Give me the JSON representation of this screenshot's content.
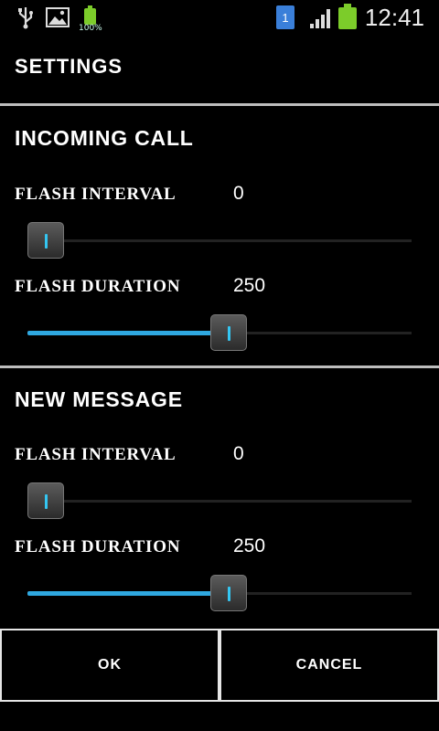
{
  "status_bar": {
    "icons": [
      "usb-icon",
      "gallery-icon",
      "battery-small-icon",
      "sim-badge-icon",
      "signal-icon",
      "battery-icon"
    ],
    "battery_small_label": "100%",
    "sim_label": "1",
    "time": "12:41"
  },
  "dialog": {
    "title": "SETTINGS",
    "sections": [
      {
        "title": "INCOMING CALL",
        "interval": {
          "label": "FLASH INTERVAL",
          "value": "0",
          "fraction": 0.0
        },
        "duration": {
          "label": "FLASH DURATION",
          "value": "250",
          "fraction": 0.5
        }
      },
      {
        "title": "NEW MESSAGE",
        "interval": {
          "label": "FLASH INTERVAL",
          "value": "0",
          "fraction": 0.0
        },
        "duration": {
          "label": "FLASH DURATION",
          "value": "250",
          "fraction": 0.5
        }
      }
    ],
    "ok_label": "OK",
    "cancel_label": "CANCEL"
  },
  "colors": {
    "accent": "#2fa8e0",
    "divider": "#bdbdbd",
    "background": "#000000"
  }
}
